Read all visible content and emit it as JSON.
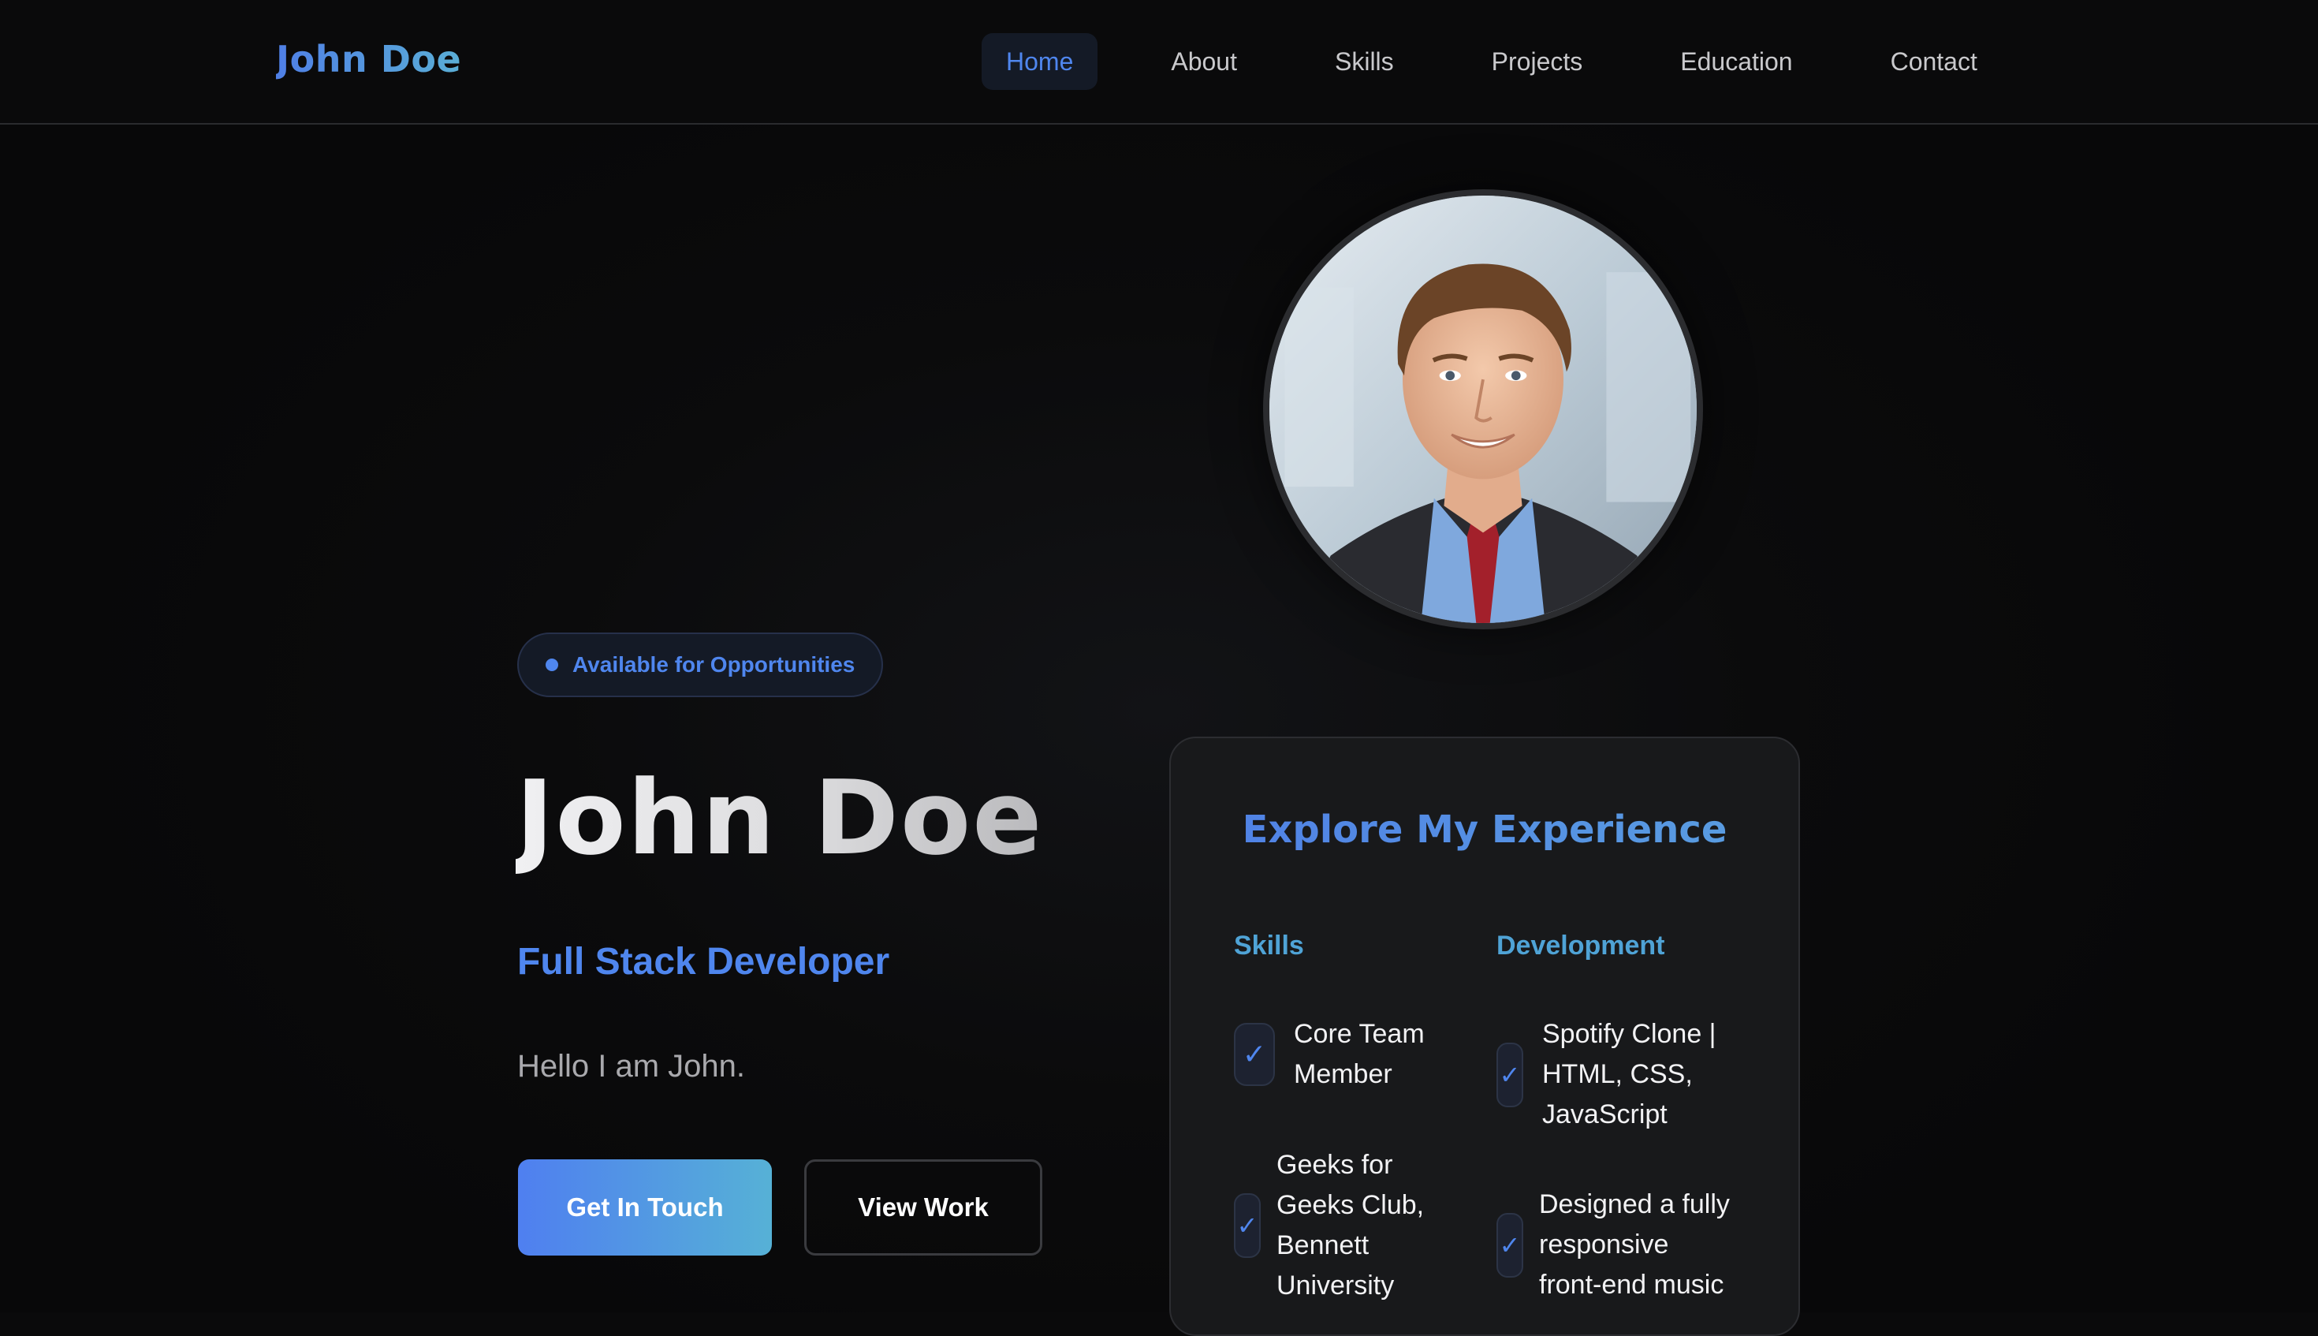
{
  "nav": {
    "brand": "John Doe",
    "links": [
      "Home",
      "About",
      "Skills",
      "Projects",
      "Education",
      "Contact"
    ],
    "active": "Home"
  },
  "hero": {
    "badge": "Available for Opportunities",
    "name": "John Doe",
    "role": "Full Stack Developer",
    "intro": "Hello I am John.",
    "primary_button": "Get In Touch",
    "secondary_button": "View Work"
  },
  "experience": {
    "title": "Explore My Experience",
    "columns": [
      {
        "heading": "Skills",
        "items": [
          {
            "lines": [
              "Core Team",
              "Member"
            ]
          },
          {
            "lines": [
              "Geeks for",
              "Geeks Club,",
              "Bennett",
              "University"
            ]
          }
        ]
      },
      {
        "heading": "Development",
        "items": [
          {
            "lines": [
              "Spotify Clone |",
              "HTML, CSS,",
              "JavaScript"
            ]
          },
          {
            "lines": [
              "Designed a fully",
              "responsive",
              "front-end music"
            ]
          }
        ]
      }
    ],
    "check_glyph": "✓"
  },
  "colors": {
    "accent": "#4f86ee",
    "accent_teal": "#4fa3d6",
    "background": "#0a0a0b",
    "card": "#18191b"
  },
  "icons": {
    "badge_dot": "status-dot-icon",
    "check": "check-icon"
  }
}
